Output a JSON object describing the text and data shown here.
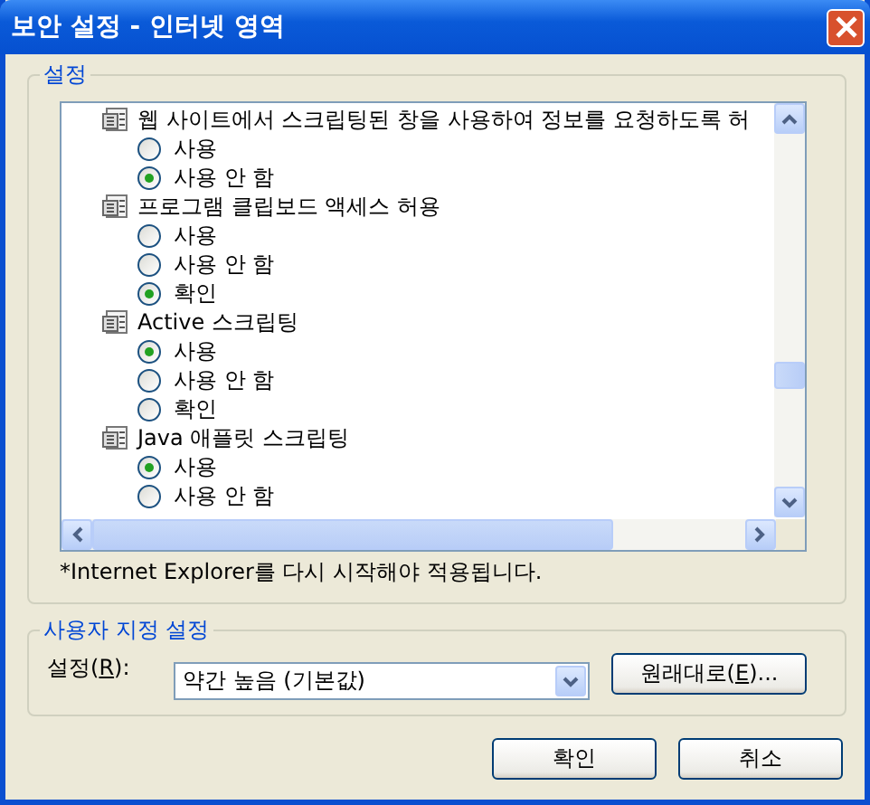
{
  "window": {
    "title": "보안 설정 - 인터넷 영역"
  },
  "settings_group": {
    "label": "설정",
    "items": [
      {
        "label": "웹 사이트에서 스크립팅된 창을 사용하여 정보를 요청하도록 허",
        "options": [
          {
            "label": "사용",
            "selected": false
          },
          {
            "label": "사용 안 함",
            "selected": true
          }
        ]
      },
      {
        "label": "프로그램 클립보드 액세스 허용",
        "options": [
          {
            "label": "사용",
            "selected": false
          },
          {
            "label": "사용 안 함",
            "selected": false
          },
          {
            "label": "확인",
            "selected": true
          }
        ]
      },
      {
        "label": "Active 스크립팅",
        "options": [
          {
            "label": "사용",
            "selected": true
          },
          {
            "label": "사용 안 함",
            "selected": false
          },
          {
            "label": "확인",
            "selected": false
          }
        ]
      },
      {
        "label": "Java 애플릿 스크립팅",
        "options": [
          {
            "label": "사용",
            "selected": true
          },
          {
            "label": "사용 안 함",
            "selected": false
          }
        ]
      }
    ],
    "note": "*Internet Explorer를 다시 시작해야 적용됩니다."
  },
  "custom_group": {
    "label": "사용자 지정 설정",
    "setting_label": {
      "before": "설정(",
      "key": "R",
      "after": "):"
    },
    "dropdown_value": "약간 높음 (기본값)",
    "reset_button": {
      "before": "원래대로(",
      "key": "E",
      "after": ")..."
    }
  },
  "buttons": [
    "확인",
    "취소"
  ]
}
